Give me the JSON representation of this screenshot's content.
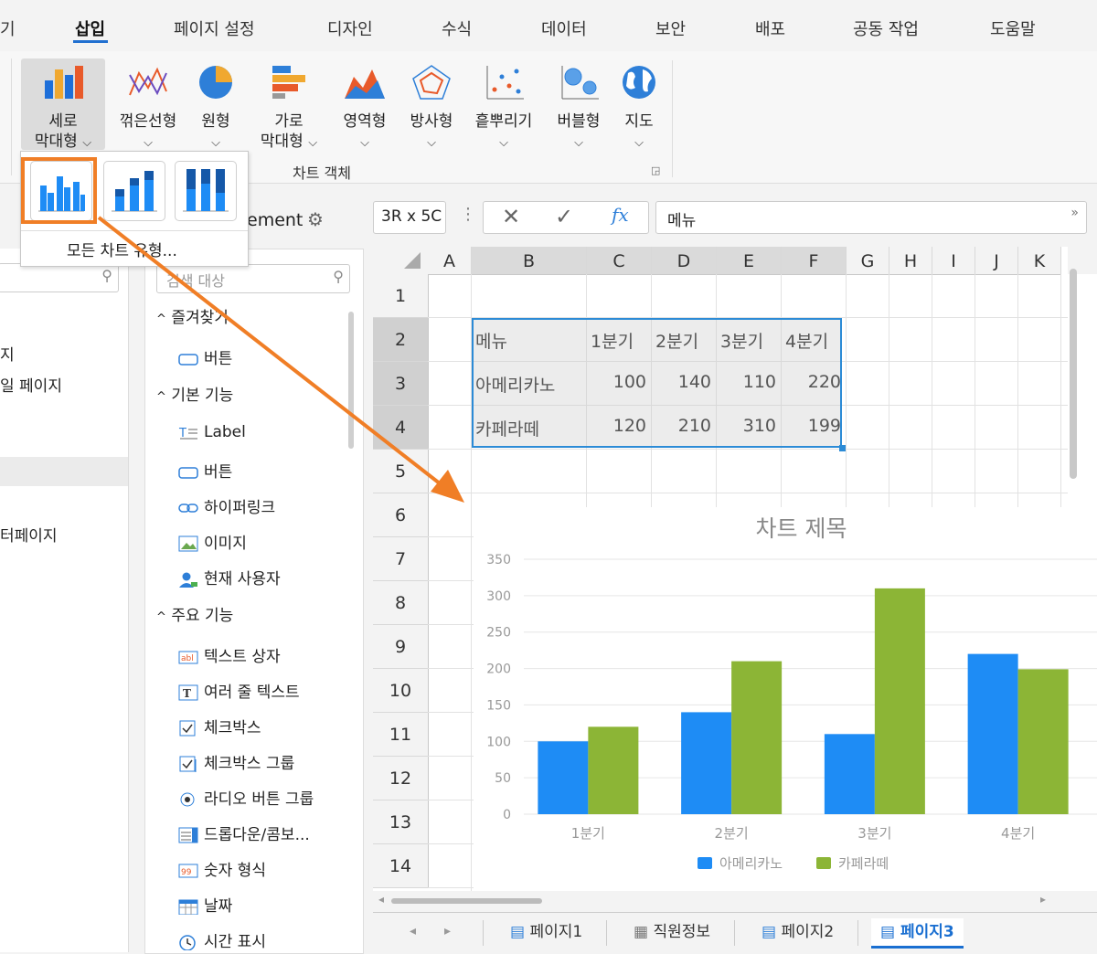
{
  "menu": {
    "items": [
      "기",
      "삽입",
      "페이지 설정",
      "디자인",
      "수식",
      "데이터",
      "보안",
      "배포",
      "공동 작업",
      "도움말"
    ]
  },
  "ribbon": {
    "buttons": [
      {
        "label1": "세로",
        "label2": "막대형",
        "icon": "column-chart-icon"
      },
      {
        "label1": "꺾은선형",
        "label2": "",
        "icon": "line-chart-icon"
      },
      {
        "label1": "원형",
        "label2": "",
        "icon": "pie-chart-icon"
      },
      {
        "label1": "가로",
        "label2": "막대형",
        "icon": "bar-chart-icon"
      },
      {
        "label1": "영역형",
        "label2": "",
        "icon": "area-chart-icon"
      },
      {
        "label1": "방사형",
        "label2": "",
        "icon": "radar-chart-icon"
      },
      {
        "label1": "흩뿌리기",
        "label2": "",
        "icon": "scatter-chart-icon"
      },
      {
        "label1": "버블형",
        "label2": "",
        "icon": "bubble-chart-icon"
      },
      {
        "label1": "지도",
        "label2": "",
        "icon": "map-globe-icon"
      }
    ],
    "group_label": "차트 객체"
  },
  "gallery": {
    "all_types_label": "모든 차트 유형..."
  },
  "left_panel": {
    "items": [
      "지",
      "일 페이지",
      "터페이지"
    ]
  },
  "mid_panel": {
    "partial_header": "ement",
    "search_placeholder": "검색 대상",
    "groups": [
      {
        "title": "즐겨찾기",
        "items": [
          {
            "label": "버튼",
            "icon": "button-icon"
          }
        ]
      },
      {
        "title": "기본 기능",
        "items": [
          {
            "label": "Label",
            "icon": "label-icon"
          },
          {
            "label": "버튼",
            "icon": "button-icon"
          },
          {
            "label": "하이퍼링크",
            "icon": "hyperlink-icon"
          },
          {
            "label": "이미지",
            "icon": "image-icon"
          },
          {
            "label": "현재 사용자",
            "icon": "user-icon"
          }
        ]
      },
      {
        "title": "주요 기능",
        "items": [
          {
            "label": "텍스트 상자",
            "icon": "textbox-icon"
          },
          {
            "label": "여러 줄 텍스트",
            "icon": "multiline-text-icon"
          },
          {
            "label": "체크박스",
            "icon": "checkbox-icon"
          },
          {
            "label": "체크박스 그룹",
            "icon": "checkbox-group-icon"
          },
          {
            "label": "라디오 버튼 그룹",
            "icon": "radio-group-icon"
          },
          {
            "label": "드롭다운/콤보...",
            "icon": "dropdown-icon"
          },
          {
            "label": "숫자 형식",
            "icon": "number-format-icon"
          },
          {
            "label": "날짜",
            "icon": "date-icon"
          },
          {
            "label": "시간 표시",
            "icon": "clock-icon"
          }
        ]
      }
    ]
  },
  "formula": {
    "namebox": "3R x 5C",
    "value": "메뉴"
  },
  "sheet": {
    "columns": [
      "A",
      "B",
      "C",
      "D",
      "E",
      "F",
      "G",
      "H",
      "I",
      "J",
      "K"
    ],
    "rows": [
      "1",
      "2",
      "3",
      "4",
      "5",
      "6",
      "7",
      "8",
      "9",
      "10",
      "11",
      "12",
      "13",
      "14"
    ],
    "table": [
      [
        "메뉴",
        "1분기",
        "2분기",
        "3분기",
        "4분기"
      ],
      [
        "아메리카노",
        "100",
        "140",
        "110",
        "220"
      ],
      [
        "카페라떼",
        "120",
        "210",
        "310",
        "199"
      ]
    ]
  },
  "tabs": [
    "페이지1",
    "직원정보",
    "페이지2",
    "페이지3"
  ],
  "colors": {
    "series1": "#1e8cf5",
    "series2": "#8cb536",
    "accent": "#f07e26",
    "selection": "#2c8bd6"
  },
  "chart_data": {
    "type": "bar",
    "title": "차트 제목",
    "categories": [
      "1분기",
      "2분기",
      "3분기",
      "4분기"
    ],
    "series": [
      {
        "name": "아메리카노",
        "values": [
          100,
          140,
          110,
          220
        ]
      },
      {
        "name": "카페라떼",
        "values": [
          120,
          210,
          310,
          199
        ]
      }
    ],
    "yticks": [
      "0",
      "50",
      "100",
      "150",
      "200",
      "250",
      "300",
      "350"
    ],
    "ylim": [
      0,
      350
    ],
    "grid": true,
    "legend": "bottom"
  }
}
